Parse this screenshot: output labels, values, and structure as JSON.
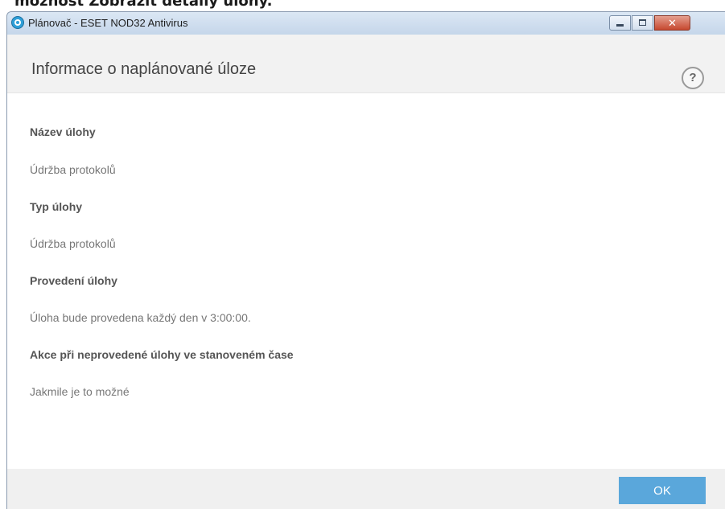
{
  "caption": "možnost Zobrazit detaily úlohy.",
  "window": {
    "title": "Plánovač - ESET NOD32 Antivirus",
    "buttons": {
      "close_glyph": "✕"
    }
  },
  "header": {
    "title": "Informace o naplánované úloze",
    "help_glyph": "?"
  },
  "details": [
    {
      "label": "Název úlohy",
      "value": "Údržba protokolů"
    },
    {
      "label": "Typ úlohy",
      "value": "Údržba protokolů"
    },
    {
      "label": "Provedení úlohy",
      "value": "Úloha bude provedena každý den v 3:00:00."
    },
    {
      "label": "Akce při neprovedené úlohy ve stanoveném čase",
      "value": "Jakmile je to možné"
    }
  ],
  "footer": {
    "ok_label": "OK"
  },
  "colors": {
    "accent": "#5aa7db",
    "titlebar": "#c5d6ea",
    "header_bg": "#f2f2f2",
    "close_button": "#c6482f"
  }
}
